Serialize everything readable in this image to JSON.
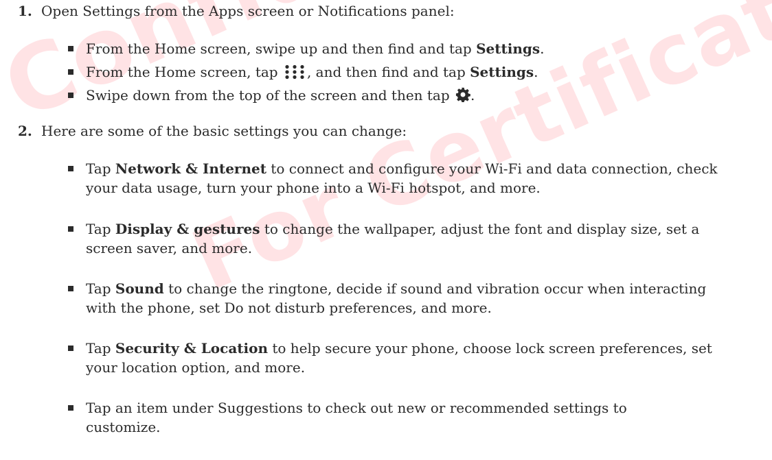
{
  "watermark": {
    "line1": "Confidential",
    "line2": "For Certification"
  },
  "steps": [
    {
      "number": "1.",
      "text": "Open Settings from the Apps screen or Notifications panel:",
      "bullets": [
        {
          "pre": "From the Home screen, swipe up and then find and tap ",
          "bold": "Settings",
          "post": "."
        },
        {
          "pre": "From the Home screen, tap ",
          "icon": "apps-grid-icon",
          "mid": ", and then find and tap ",
          "bold": "Settings",
          "post": "."
        },
        {
          "pre": "Swipe down from the top of the screen and then tap ",
          "icon": "gear-icon",
          "post": "."
        }
      ]
    },
    {
      "number": "2.",
      "text": "Here are some of the basic settings you can change:",
      "bullets": [
        {
          "pre": "Tap ",
          "bold": "Network & Internet",
          "post": " to connect and configure your Wi-Fi and data connection, check your data usage, turn your phone into a Wi-Fi hotspot, and more."
        },
        {
          "pre": "Tap ",
          "bold": "Display & gestures",
          "post": " to change the wallpaper, adjust the font and display size, set a screen saver, and more."
        },
        {
          "pre": "Tap ",
          "bold": "Sound",
          "post": " to change the ringtone, decide if sound and vibration occur when interacting with the phone, set Do not disturb preferences, and more."
        },
        {
          "pre": "Tap ",
          "bold": "Security & Location",
          "post": " to help secure your phone, choose lock screen preferences, set your location option, and more."
        },
        {
          "pre": "Tap an item under Suggestions to check out new or recommended settings to customize."
        }
      ]
    }
  ]
}
